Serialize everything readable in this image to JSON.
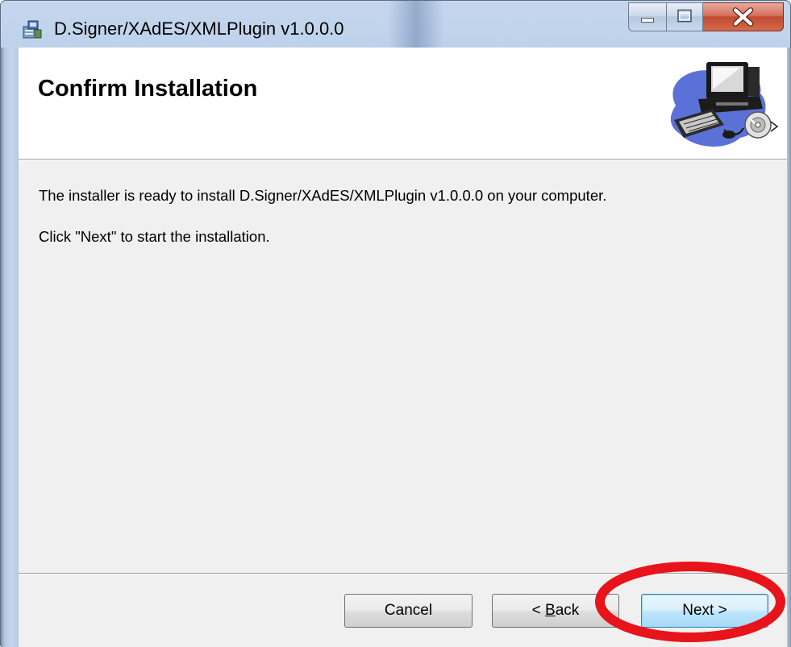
{
  "window": {
    "title": "D.Signer/XAdES/XMLPlugin v1.0.0.0",
    "caption_buttons": [
      "minimize-icon",
      "maximize-icon",
      "close-icon"
    ]
  },
  "header": {
    "title": "Confirm Installation",
    "graphic_icon": "computer-setup-icon"
  },
  "body": {
    "line1": "The installer is ready to install D.Signer/XAdES/XMLPlugin v1.0.0.0 on your computer.",
    "line2": "Click \"Next\" to start the installation."
  },
  "buttons": {
    "cancel": "Cancel",
    "back_prefix": "< ",
    "back_key": "B",
    "back_rest": "ack",
    "next": "Next >"
  },
  "colors": {
    "highlight": "#e8141b",
    "dialog_background": "#f0f0f0",
    "close_button": "#c14a2f"
  }
}
